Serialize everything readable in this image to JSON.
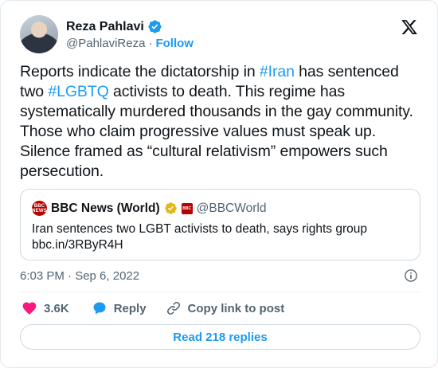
{
  "author": {
    "name": "Reza Pahlavi",
    "handle": "@PahlaviReza",
    "separator": "·",
    "follow_label": "Follow"
  },
  "tweet": {
    "text_segments": [
      {
        "text": "Reports indicate the dictatorship in ",
        "hashtag": false
      },
      {
        "text": "#Iran",
        "hashtag": true
      },
      {
        "text": " has sentenced two ",
        "hashtag": false
      },
      {
        "text": "#LGBTQ",
        "hashtag": true
      },
      {
        "text": " activists to death. This regime has systematically murdered thousands in the gay community. Those who claim progressive values must speak up. Silence framed as “cultural relativism” empowers such persecution.",
        "hashtag": false
      }
    ]
  },
  "quote": {
    "avatar_text": "BBC NEWS",
    "name": "BBC News (World)",
    "affiliate_text": "BBC",
    "handle": "@BBCWorld",
    "text": "Iran sentences two LGBT activists to death, says rights group",
    "link": "bbc.in/3RByR4H"
  },
  "meta": {
    "timestamp": "6:03 PM · Sep 6, 2022"
  },
  "actions": {
    "likes": "3.6K",
    "reply_label": "Reply",
    "copy_label": "Copy link to post"
  },
  "replies_button": {
    "label": "Read 218 replies"
  },
  "colors": {
    "accent": "#1d9bf0",
    "like": "#f91880",
    "verified": "#1d9bf0",
    "gold_badge": "#e2b719",
    "bbc_red": "#b80000",
    "muted_text": "#536471"
  },
  "icons": {
    "verified": "verified-badge-icon",
    "logo": "x-logo-icon",
    "gold": "gold-verified-badge-icon",
    "info": "info-icon",
    "like": "heart-icon",
    "reply": "speech-bubble-icon",
    "copy": "link-icon"
  }
}
